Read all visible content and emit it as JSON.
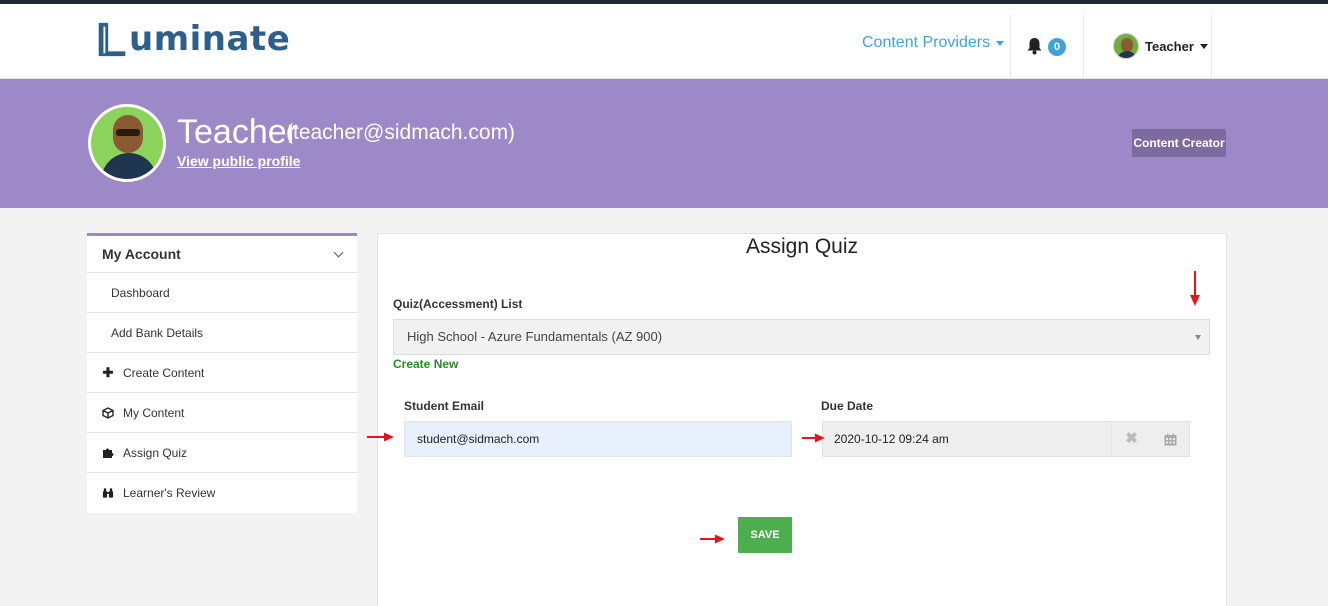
{
  "app": {
    "logo_text": "uminate",
    "logo_full": "Luminate"
  },
  "navbar": {
    "providers_label": "Content Providers",
    "notification_count": "0",
    "user_label": "Teacher"
  },
  "profile": {
    "name": "Teacher",
    "email": "(teacher@sidmach.com)",
    "public_link": "View public profile",
    "role_button": "Content Creator"
  },
  "sidebar": {
    "heading": "My Account",
    "items": [
      {
        "label": "Dashboard",
        "icon": ""
      },
      {
        "label": "Add Bank Details",
        "icon": ""
      },
      {
        "label": "Create Content",
        "icon": "plus-icon"
      },
      {
        "label": "My Content",
        "icon": "cube-icon"
      },
      {
        "label": "Assign Quiz",
        "icon": "puzzle-icon"
      },
      {
        "label": "Learner's Review",
        "icon": "binoculars-icon"
      }
    ]
  },
  "form": {
    "title": "Assign Quiz",
    "quiz_label": "Quiz(Accessment) List",
    "quiz_selected": "High School - Azure Fundamentals (AZ 900)",
    "create_new": "Create New",
    "email_label": "Student Email",
    "email_value": "student@sidmach.com",
    "due_label": "Due Date",
    "due_value": "2020-10-12 09:24 am",
    "save_label": "SAVE"
  },
  "colors": {
    "accent": "#3ea3dc",
    "profile_band": "#9d89c8",
    "save": "#4cae4c",
    "annotation_arrow": "#e8141b"
  }
}
